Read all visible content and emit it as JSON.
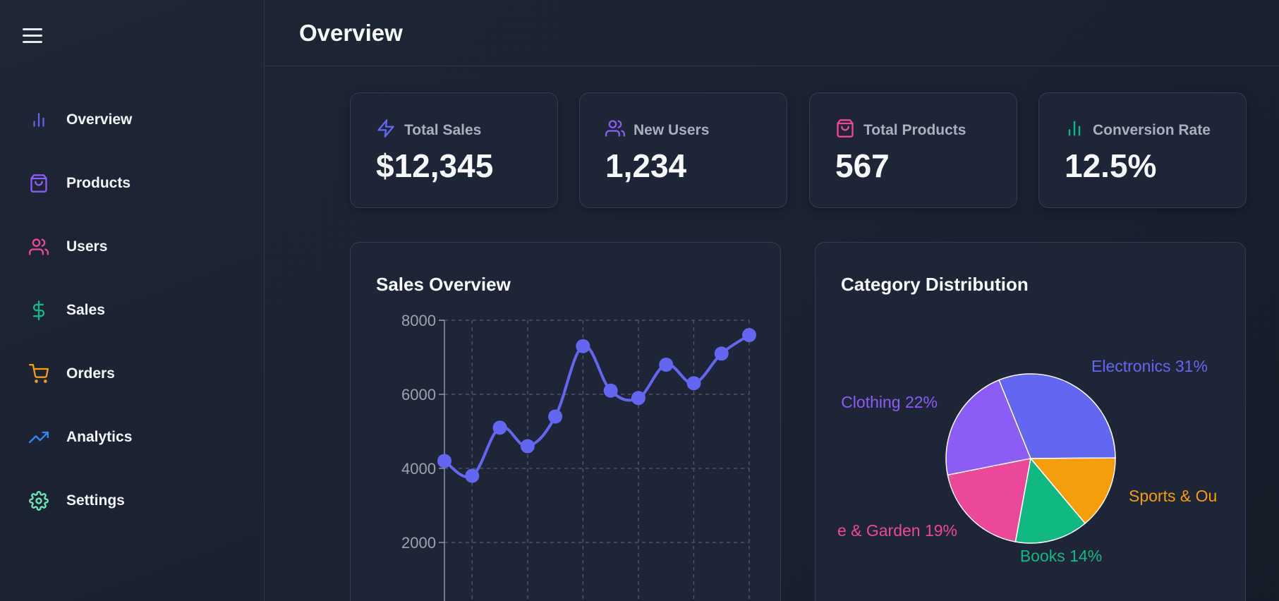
{
  "header": {
    "title": "Overview"
  },
  "sidebar": {
    "items": [
      {
        "label": "Overview",
        "icon": "bar-chart-icon",
        "color": "#6366f1"
      },
      {
        "label": "Products",
        "icon": "shopping-bag-icon",
        "color": "#8b5cf6"
      },
      {
        "label": "Users",
        "icon": "users-icon",
        "color": "#ec4899"
      },
      {
        "label": "Sales",
        "icon": "dollar-sign-icon",
        "color": "#10b981"
      },
      {
        "label": "Orders",
        "icon": "shopping-cart-icon",
        "color": "#f59e0b"
      },
      {
        "label": "Analytics",
        "icon": "trending-up-icon",
        "color": "#3b82f6"
      },
      {
        "label": "Settings",
        "icon": "settings-icon",
        "color": "#6ee7b7"
      }
    ]
  },
  "stats": [
    {
      "label": "Total Sales",
      "value": "$12,345",
      "icon": "zap-icon",
      "color": "#6366f1"
    },
    {
      "label": "New Users",
      "value": "1,234",
      "icon": "users-icon",
      "color": "#8b5cf6"
    },
    {
      "label": "Total Products",
      "value": "567",
      "icon": "shopping-bag-icon",
      "color": "#ec4899"
    },
    {
      "label": "Conversion Rate",
      "value": "12.5%",
      "icon": "bar-chart-icon",
      "color": "#10b981"
    }
  ],
  "sales_panel": {
    "title": "Sales Overview"
  },
  "category_panel": {
    "title": "Category Distribution"
  },
  "chart_data": [
    {
      "type": "line",
      "title": "Sales Overview",
      "y_ticks": [
        "8000",
        "6000",
        "4000",
        "2000"
      ],
      "ylim": [
        0,
        8000
      ],
      "grid": true,
      "series": [
        {
          "color": "#6366f1",
          "values": [
            4200,
            3800,
            5100,
            4600,
            5400,
            7300,
            6100,
            5900,
            6800,
            6300,
            7100,
            7600
          ]
        }
      ]
    },
    {
      "type": "pie",
      "title": "Category Distribution",
      "slices": [
        {
          "name": "Electronics",
          "value": 31,
          "label": "Electronics 31%",
          "color": "#6366f1"
        },
        {
          "name": "Sports & Outdoors",
          "value": 14,
          "label": "Sports & Ou",
          "color": "#f59e0b"
        },
        {
          "name": "Books",
          "value": 14,
          "label": "Books 14%",
          "color": "#10b981"
        },
        {
          "name": "Home & Garden",
          "value": 19,
          "label": "e & Garden 19%",
          "color": "#ec4899"
        },
        {
          "name": "Clothing",
          "value": 22,
          "label": "Clothing 22%",
          "color": "#8b5cf6"
        }
      ]
    }
  ]
}
